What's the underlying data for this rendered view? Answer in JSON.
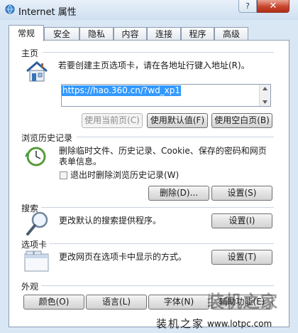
{
  "window": {
    "title": "Internet 属性",
    "help": "?",
    "close": "✕"
  },
  "tabs": [
    "常规",
    "安全",
    "隐私",
    "内容",
    "连接",
    "程序",
    "高级"
  ],
  "home": {
    "heading": "主页",
    "desc": "若要创建主页选项卡，请在各地址行键入地址(R)。",
    "url": "https://hao.360.cn/?wd_xp1",
    "btn_current": "使用当前页(C)",
    "btn_default": "使用默认值(F)",
    "btn_blank": "使用空白页(B)"
  },
  "history": {
    "heading": "浏览历史记录",
    "desc1": "删除临时文件、历史记录、Cookie、保存的密码和网页",
    "desc2": "表单信息。",
    "checkbox": "退出时删除浏览历史记录(W)",
    "btn_delete": "删除(D)...",
    "btn_settings": "设置(S)"
  },
  "search": {
    "heading": "搜索",
    "desc": "更改默认的搜索提供程序。",
    "btn_settings": "设置(I)"
  },
  "tabs_section": {
    "heading": "选项卡",
    "desc": "更改网页在选项卡中显示的方式。",
    "btn_settings": "设置(T)"
  },
  "appearance": {
    "heading": "外观",
    "btn_colors": "颜色(O)",
    "btn_languages": "语言(L)",
    "btn_fonts": "字体(N)",
    "btn_accessibility": "辅助功能(E)"
  },
  "watermark": {
    "text1": "装机之家",
    "text2": "www.lotpc.com",
    "text3": "装机之家"
  }
}
